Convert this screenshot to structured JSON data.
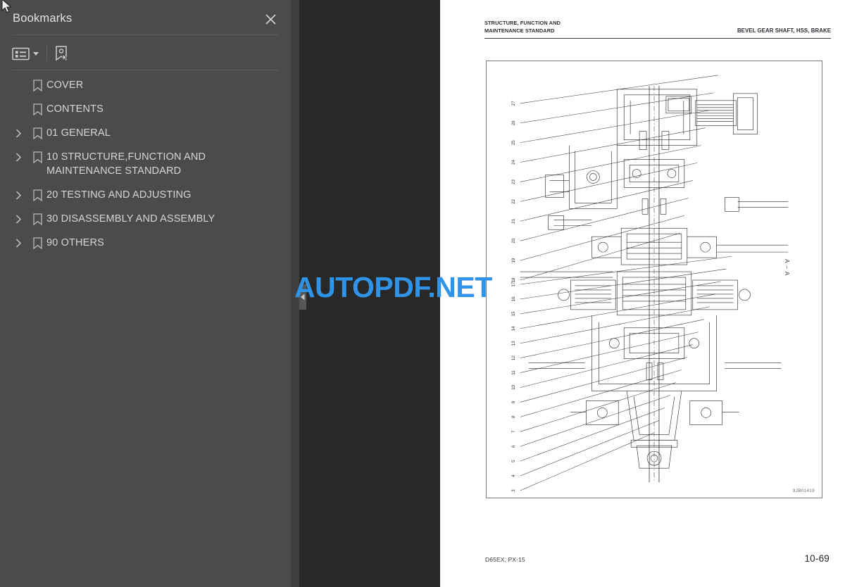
{
  "sidebar": {
    "title": "Bookmarks",
    "close_icon": "close-icon",
    "toolbar": {
      "list_options_icon": "list-options-icon",
      "caret_icon": "chevron-down-icon",
      "new_bookmark_icon": "new-bookmark-icon"
    },
    "items": [
      {
        "label": "COVER",
        "expandable": false
      },
      {
        "label": "CONTENTS",
        "expandable": false
      },
      {
        "label": "01 GENERAL",
        "expandable": true
      },
      {
        "label": "10 STRUCTURE,FUNCTION AND MAINTENANCE STANDARD",
        "expandable": true
      },
      {
        "label": "20 TESTING AND ADJUSTING",
        "expandable": true
      },
      {
        "label": "30 DISASSEMBLY AND ASSEMBLY",
        "expandable": true
      },
      {
        "label": "90 OTHERS",
        "expandable": true
      }
    ]
  },
  "viewer": {
    "collapse_handle_icon": "collapse-left-icon",
    "watermark": "AUTOPDF.NET"
  },
  "page": {
    "header_left": "STRUCTURE, FUNCTION AND\nMAINTENANCE STANDARD",
    "header_left_line1": "STRUCTURE, FUNCTION AND",
    "header_left_line2": "MAINTENANCE STANDARD",
    "header_right": "BEVEL GEAR SHAFT, HSS, BRAKE",
    "drawing_id": "9JB01419",
    "section_label": "A – A",
    "footer_left": "D65EX, PX-15",
    "footer_right": "10-69",
    "callouts_left_upper": [
      "27",
      "26",
      "25",
      "24",
      "23",
      "22",
      "21",
      "20",
      "19",
      "18"
    ],
    "callouts_left_lower": [
      "17",
      "16",
      "15",
      "14",
      "13",
      "12",
      "11",
      "10",
      "9",
      "8",
      "7",
      "6",
      "5",
      "4",
      "3"
    ]
  },
  "colors": {
    "sidebar_bg": "#4b4b4b",
    "sidebar_edge": "#3f3f3f",
    "viewer_bg": "#282828",
    "page_bg": "#ffffff",
    "text": "#d6d6d6",
    "watermark": "#2f94e8"
  }
}
